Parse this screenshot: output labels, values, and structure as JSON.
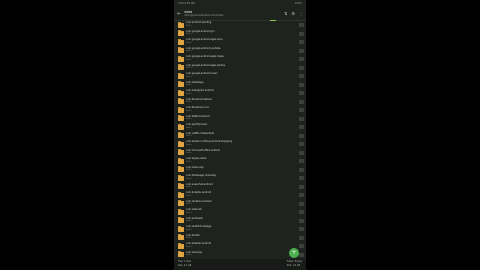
{
  "status_bar": {
    "time": "3:56 9:55 AM",
    "battery": "100%"
  },
  "toolbar": {
    "back_icon": "arrow-left-icon",
    "title": "data",
    "path": "/storage/emulated/0/Android/data",
    "sort_icon": "sort-icon",
    "settings_icon": "gear-icon",
    "more_icon": "more-vertical-icon"
  },
  "folders": [
    {
      "name": "com.android.vending",
      "sub": "Folder"
    },
    {
      "name": "com.google.android.gm",
      "sub": "Folder"
    },
    {
      "name": "com.google.android.apps.docs",
      "sub": "Folder"
    },
    {
      "name": "com.google.android.youtube",
      "sub": "Folder"
    },
    {
      "name": "com.google.android.apps.maps",
      "sub": "Folder"
    },
    {
      "name": "com.google.android.apps.photos",
      "sub": "Folder"
    },
    {
      "name": "com.google.android.music",
      "sub": "Folder"
    },
    {
      "name": "com.whatsapp",
      "sub": "Folder"
    },
    {
      "name": "com.instagram.android",
      "sub": "Folder"
    },
    {
      "name": "com.facebook.katana",
      "sub": "Folder"
    },
    {
      "name": "com.facebook.orca",
      "sub": "Folder"
    },
    {
      "name": "com.twitter.android",
      "sub": "Folder"
    },
    {
      "name": "com.spotify.music",
      "sub": "Folder"
    },
    {
      "name": "com.netflix.mediaclient",
      "sub": "Folder"
    },
    {
      "name": "com.amazon.mShop.android.shopping",
      "sub": "Folder"
    },
    {
      "name": "com.microsoft.office.outlook",
      "sub": "Folder"
    },
    {
      "name": "com.skype.raider",
      "sub": "Folder"
    },
    {
      "name": "com.viber.voip",
      "sub": "Folder"
    },
    {
      "name": "com.zhiliaoapp.musically",
      "sub": "Folder"
    },
    {
      "name": "com.snapchat.android",
      "sub": "Folder"
    },
    {
      "name": "com.linkedin.android",
      "sub": "Folder"
    },
    {
      "name": "com.dropbox.android",
      "sub": "Folder"
    },
    {
      "name": "com.ubercab",
      "sub": "Folder"
    },
    {
      "name": "com.pinterest",
      "sub": "Folder"
    },
    {
      "name": "com.reddit.frontpage",
      "sub": "Folder"
    },
    {
      "name": "com.tumblr",
      "sub": "Folder"
    },
    {
      "name": "com.shazam.android",
      "sub": "Folder"
    },
    {
      "name": "com.duolingo",
      "sub": "Folder"
    }
  ],
  "bottom_bar": {
    "left_line1": "Free: 1 Item",
    "left_line2": "Size: 4.1 GB",
    "right_line1": "Folder: Empty",
    "right_line2": "Size: 1.0 GB"
  },
  "fab": {
    "icon": "plus-icon",
    "label": "+"
  }
}
